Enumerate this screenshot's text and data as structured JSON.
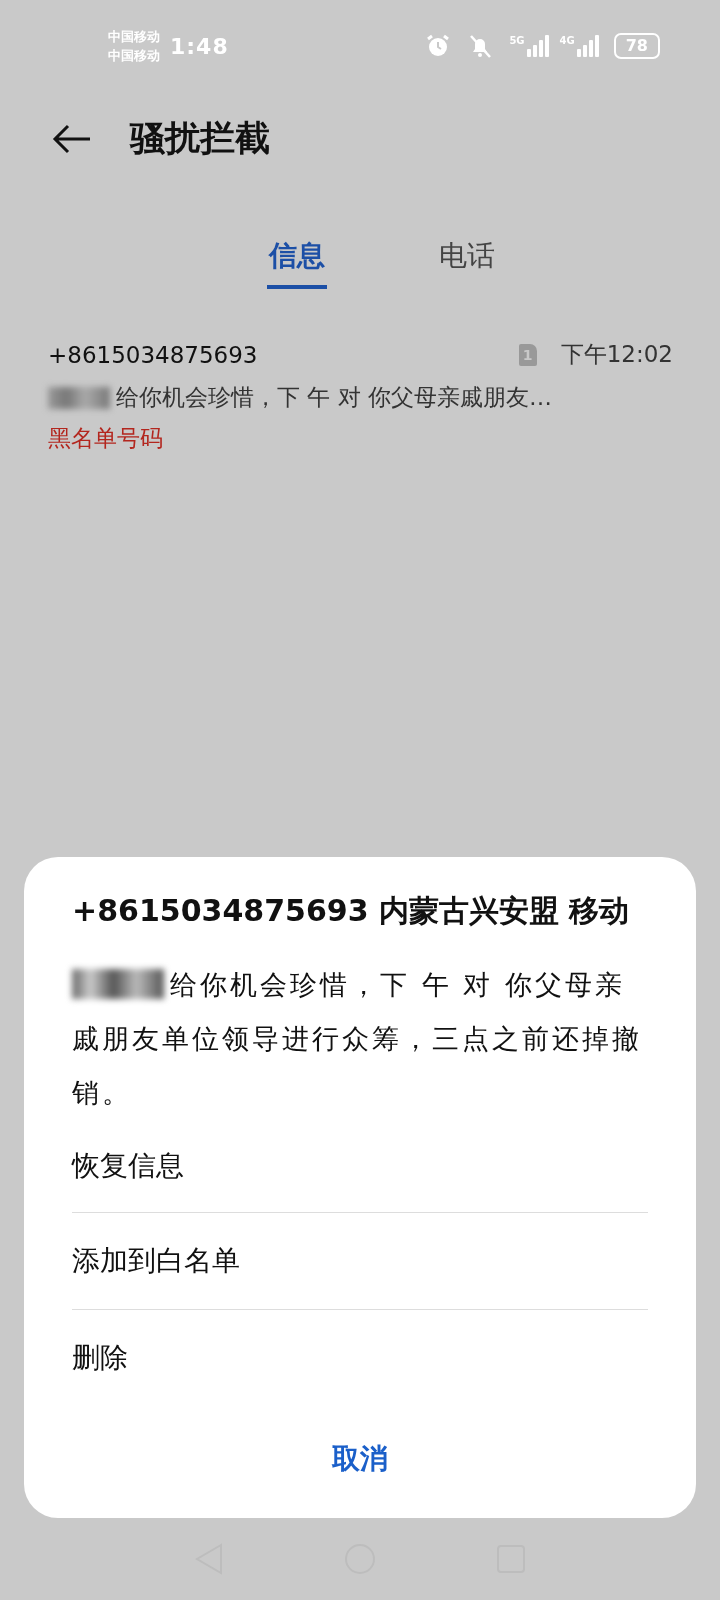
{
  "status_bar": {
    "carriers": [
      "中国移动",
      "中国移动"
    ],
    "time": "1:48",
    "networks": [
      "5G",
      "4G"
    ],
    "battery": "78"
  },
  "header": {
    "title": "骚扰拦截"
  },
  "tabs": [
    {
      "label": "信息",
      "selected": true
    },
    {
      "label": "电话",
      "selected": false
    }
  ],
  "messages": [
    {
      "sender": "+8615034875693",
      "sim": "1",
      "time": "下午12:02",
      "preview": "给你机会珍惜，下 午 对 你父母亲戚朋友…",
      "redacted": true,
      "tag": "黑名单号码"
    }
  ],
  "sheet": {
    "title": "+8615034875693 内蒙古兴安盟 移动",
    "body": "给你机会珍惜，下 午 对 你父母亲戚朋友单位领导进行众筹，三点之前还掉撤销。",
    "redacted": true,
    "actions": [
      "恢复信息",
      "添加到白名单",
      "删除"
    ],
    "cancel": "取消"
  }
}
